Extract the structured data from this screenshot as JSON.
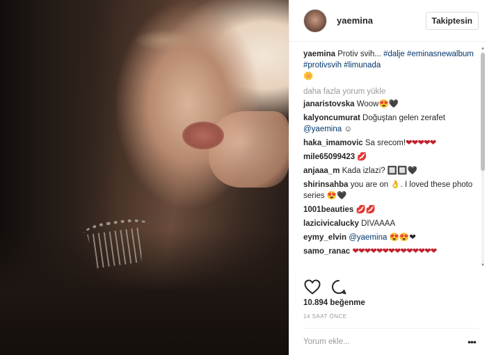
{
  "header": {
    "username": "yaemina",
    "follow_label": "Takiptesin"
  },
  "caption": {
    "user": "yaemina",
    "text": "Protiv svih... ",
    "tags": [
      "#dalje",
      "#eminasnewalbum",
      "#protivsvih",
      "#limunada"
    ],
    "emoji": "🌼"
  },
  "load_more": "daha fazla yorum yükle",
  "comments": [
    {
      "user": "janaristovska",
      "text": "Woow😍🖤"
    },
    {
      "user": "kalyoncumurat",
      "text": "Doğuştan gelen zerafet ",
      "mention": "@yaemina",
      "after": " ☺"
    },
    {
      "user": "haka_imamovic",
      "text": "Sa srecom!",
      "hearts": "❤❤❤❤❤"
    },
    {
      "user": "mile65099423",
      "text": " 💋"
    },
    {
      "user": "anjaaa_m",
      "text": "Kada izlazi? 🔲🔲🖤"
    },
    {
      "user": "shirinsahba",
      "text": "you are on 👌. I loved these photo series 😍🖤"
    },
    {
      "user": "1001beauties",
      "text": "💋💋"
    },
    {
      "user": "lazicivicalucky",
      "text": "DIVAAAA"
    },
    {
      "user": "eymy_elvin",
      "text": "",
      "mention": "@yaemina",
      "after": " 😍😍❤"
    },
    {
      "user": "samo_ranac",
      "text": "",
      "hearts": "❤❤❤❤❤❤❤❤❤❤❤❤❤❤"
    }
  ],
  "actions": {
    "like_icon": "heart-outline-icon",
    "comment_icon": "speech-bubble-icon"
  },
  "likes": "10.894 beğenme",
  "timestamp": "14 SAAT ÖNCE",
  "add_comment": {
    "placeholder": "Yorum ekle...",
    "more_icon": "ellipsis-icon"
  },
  "colors": {
    "link": "#003569",
    "heart": "#c0202a",
    "muted": "#999999",
    "border": "#efefef"
  }
}
